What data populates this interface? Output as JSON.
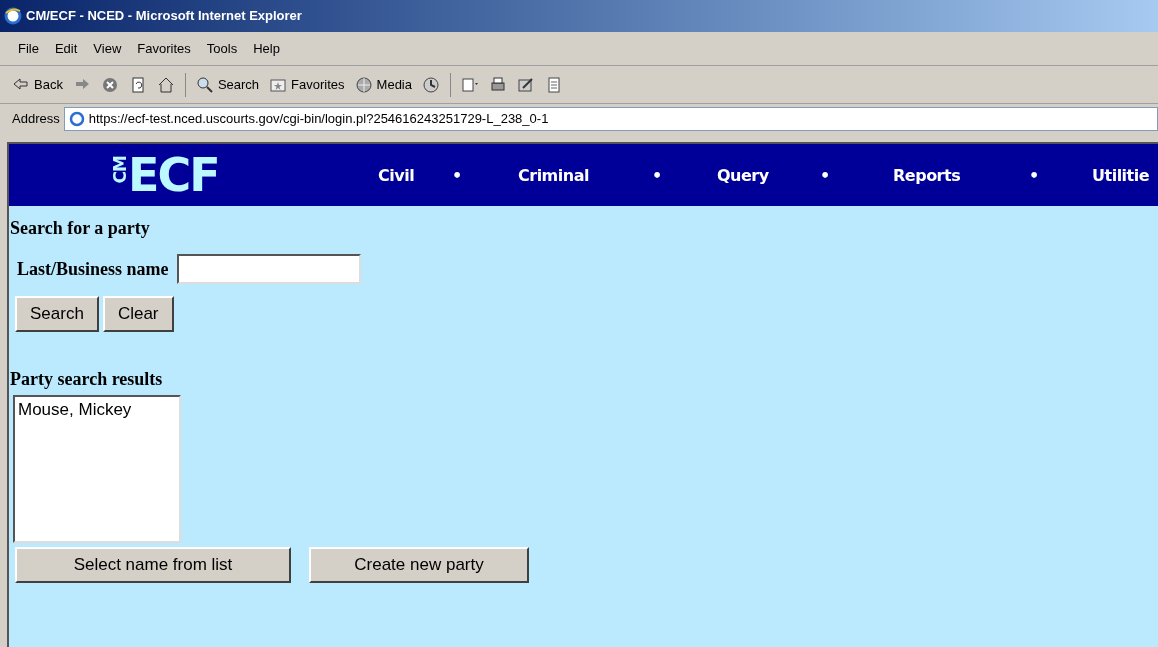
{
  "window": {
    "title": "CM/ECF - NCED - Microsoft Internet Explorer"
  },
  "menu_bar": [
    "File",
    "Edit",
    "View",
    "Favorites",
    "Tools",
    "Help"
  ],
  "toolbar": [
    {
      "kind": "back",
      "label": "Back"
    },
    {
      "kind": "forward"
    },
    {
      "kind": "stop"
    },
    {
      "kind": "refresh"
    },
    {
      "kind": "home"
    },
    {
      "kind": "sep"
    },
    {
      "kind": "search",
      "label": "Search"
    },
    {
      "kind": "favorites",
      "label": "Favorites"
    },
    {
      "kind": "media",
      "label": "Media"
    },
    {
      "kind": "history"
    },
    {
      "kind": "sep"
    },
    {
      "kind": "mail"
    },
    {
      "kind": "print"
    },
    {
      "kind": "edit"
    },
    {
      "kind": "discuss"
    }
  ],
  "address_bar": {
    "label": "Address",
    "url": "https://ecf-test.nced.uscourts.gov/cgi-bin/login.pl?254616243251729-L_238_0-1"
  },
  "logo": {
    "small": "CM",
    "large": "ECF"
  },
  "nav": [
    {
      "label": "Civil",
      "bullet": "•"
    },
    {
      "label": "Criminal",
      "bullet": "•"
    },
    {
      "label": "Query",
      "bullet": "•"
    },
    {
      "label": "Reports",
      "bullet": "•"
    },
    {
      "label": "Utilitie"
    }
  ],
  "search_heading": "Search for a party",
  "name_field": {
    "label": "Last/Business name"
  },
  "search_buttons": [
    "Search",
    "Clear"
  ],
  "results_heading": "Party search results",
  "results": [
    {
      "label": "Mouse, Mickey",
      "selected": false
    }
  ],
  "result_buttons": [
    "Select name from list",
    "Create new party"
  ]
}
